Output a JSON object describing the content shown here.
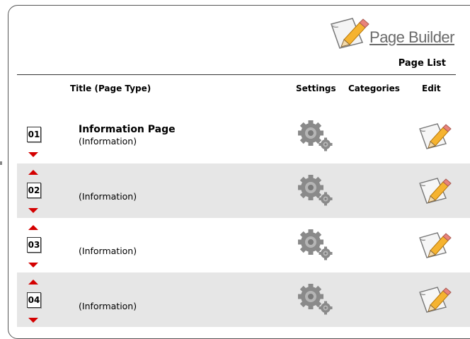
{
  "header": {
    "brand_title": "Page Builder",
    "section_title": "Page List"
  },
  "columns": {
    "title": "Title (Page Type)",
    "settings": "Settings",
    "categories": "Categories",
    "edit": "Edit"
  },
  "rows": [
    {
      "number": "01",
      "title": "Information Page",
      "type": "(Information)"
    },
    {
      "number": "02",
      "title": "",
      "type": "(Information)"
    },
    {
      "number": "03",
      "title": "",
      "type": "(Information)"
    },
    {
      "number": "04",
      "title": "",
      "type": "(Information)"
    }
  ],
  "icons": {
    "brand": "page-edit-icon",
    "settings": "gear-icon",
    "edit": "edit-page-icon",
    "move_up": "arrow-up-icon",
    "move_down": "arrow-down-icon"
  },
  "colors": {
    "arrow": "#d40000",
    "alt_row": "#e6e6e6",
    "gear": "#8a8a8a",
    "pencil": "#f0a020"
  }
}
